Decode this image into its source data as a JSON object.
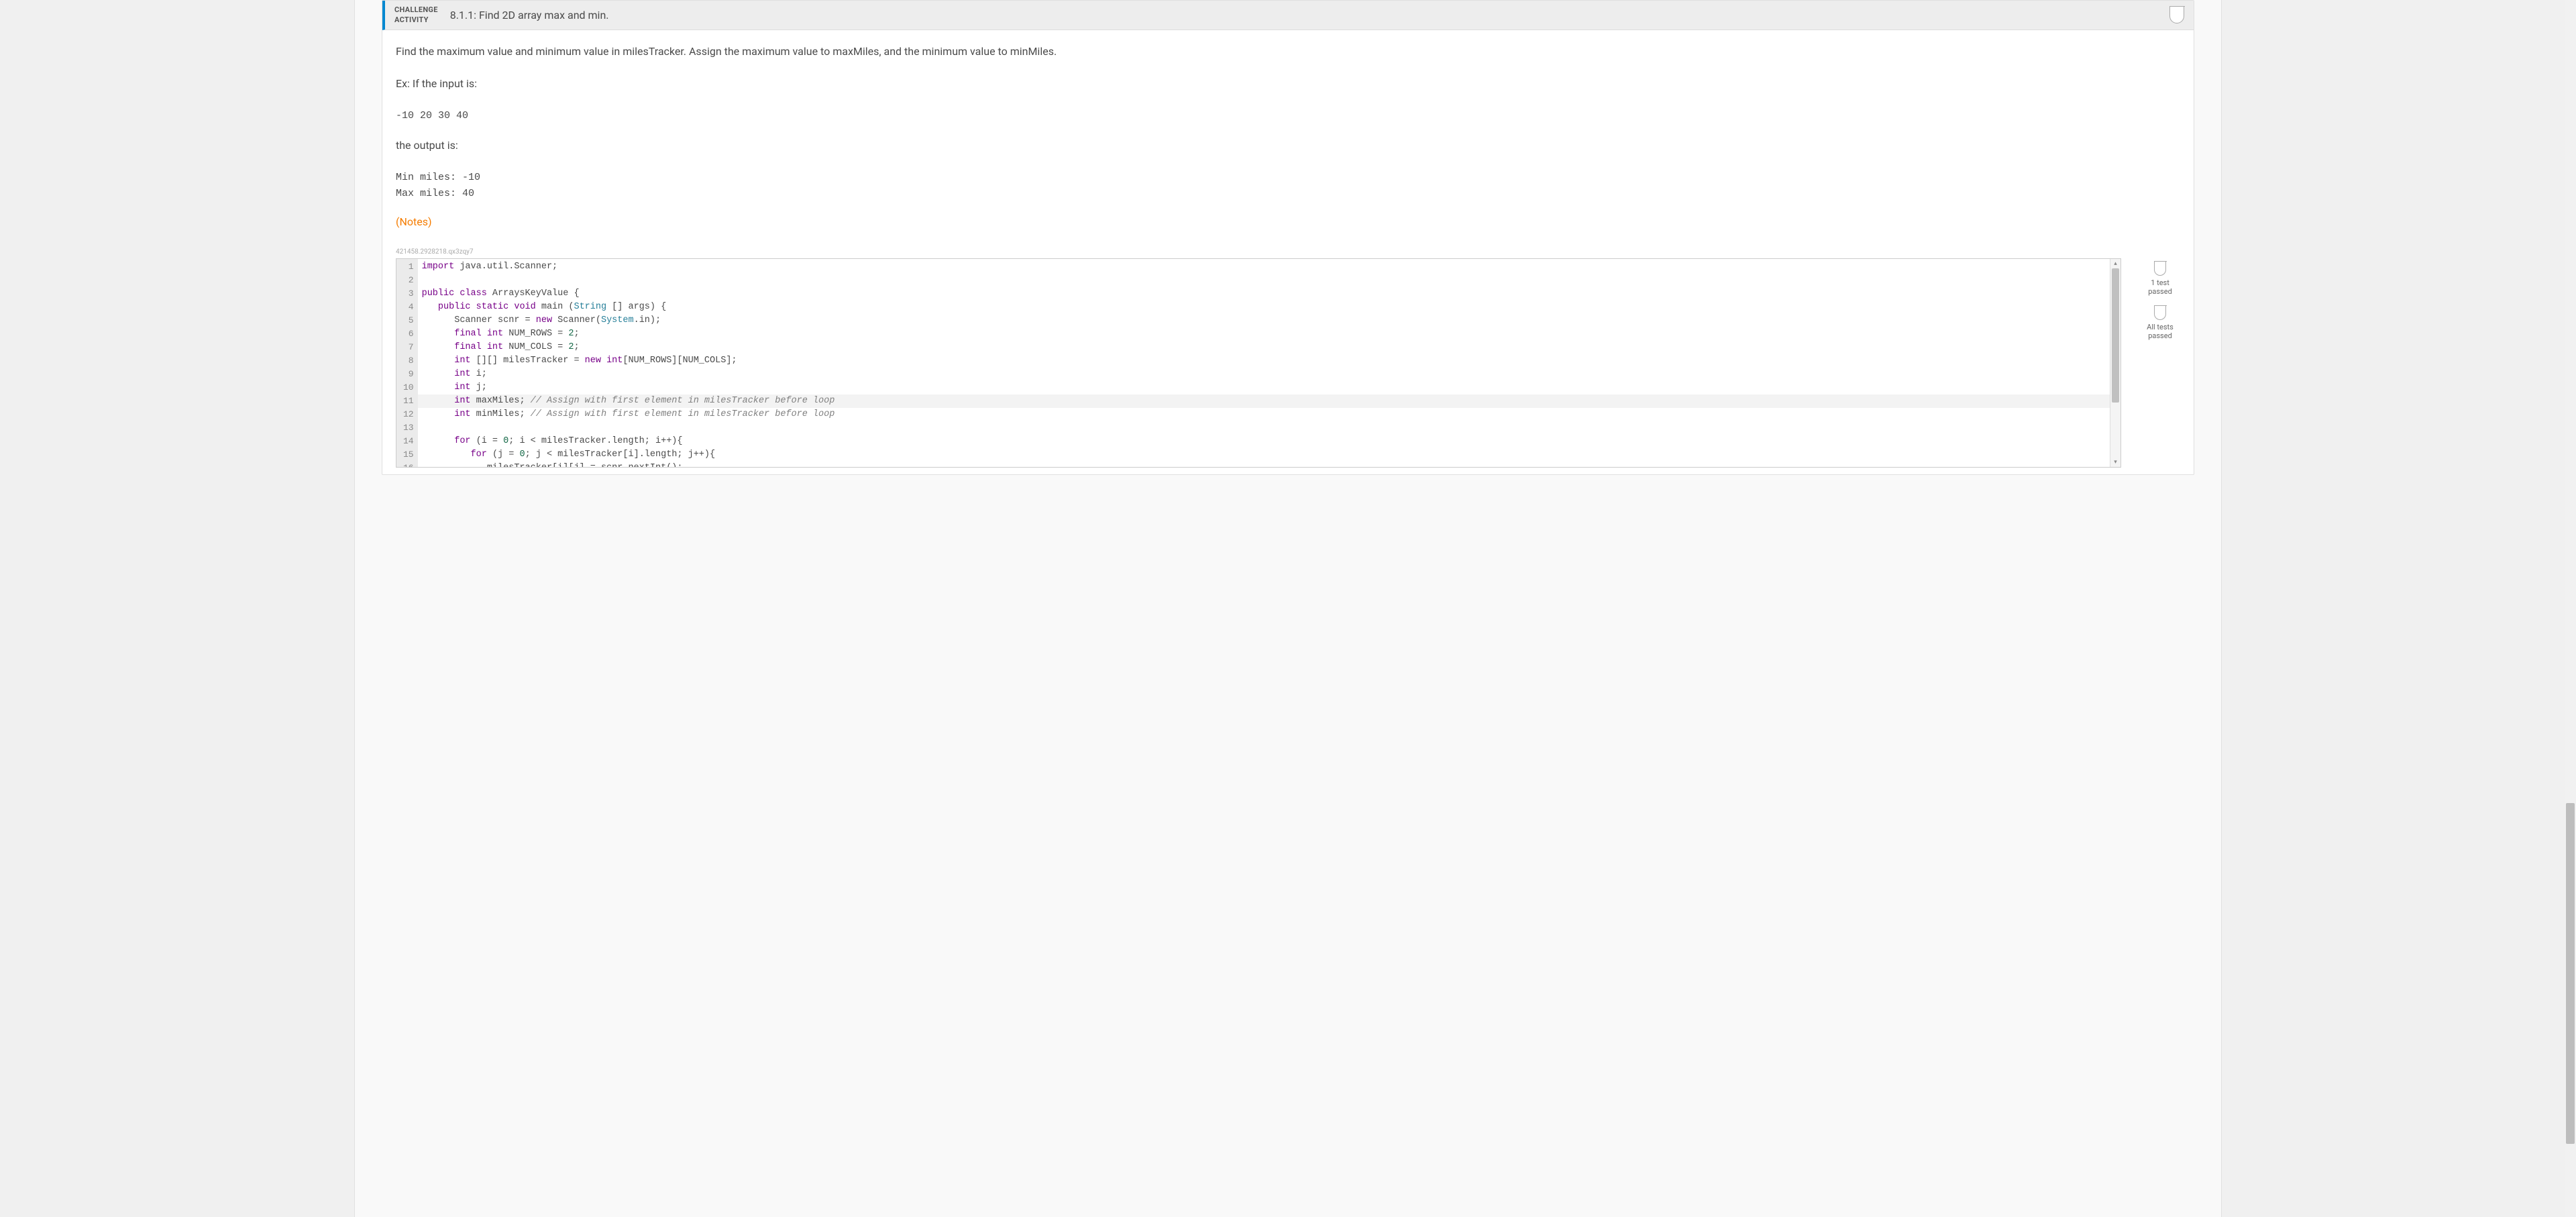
{
  "header": {
    "badge_line1": "CHALLENGE",
    "badge_line2": "ACTIVITY",
    "title": "8.1.1: Find 2D array max and min."
  },
  "description": "Find the maximum value and minimum value in milesTracker. Assign the maximum value to maxMiles, and the minimum value to minMiles.",
  "ex_label": "Ex: If the input is:",
  "ex_input": "-10 20 30 40",
  "output_label": "the output is:",
  "ex_output": "Min miles: -10\nMax miles: 40",
  "notes_label": "(Notes)",
  "watermark_id": "421458.2928218.qx3zqy7",
  "status": {
    "one_test": "1 test",
    "passed": "passed",
    "all_tests": "All tests"
  },
  "code_lines": [
    [
      {
        "t": "import",
        "c": "kw"
      },
      {
        "t": " java.util.Scanner;",
        "c": ""
      }
    ],
    [
      {
        "t": "",
        "c": ""
      }
    ],
    [
      {
        "t": "public class",
        "c": "kw"
      },
      {
        "t": " ArraysKeyValue {",
        "c": ""
      }
    ],
    [
      {
        "t": "   ",
        "c": ""
      },
      {
        "t": "public static void",
        "c": "kw"
      },
      {
        "t": " main (",
        "c": ""
      },
      {
        "t": "String",
        "c": "type"
      },
      {
        "t": " [] args) {",
        "c": ""
      }
    ],
    [
      {
        "t": "      Scanner scnr = ",
        "c": ""
      },
      {
        "t": "new",
        "c": "kw"
      },
      {
        "t": " Scanner(",
        "c": ""
      },
      {
        "t": "System",
        "c": "type"
      },
      {
        "t": ".in);",
        "c": ""
      }
    ],
    [
      {
        "t": "      ",
        "c": ""
      },
      {
        "t": "final int",
        "c": "kw"
      },
      {
        "t": " NUM_ROWS = ",
        "c": ""
      },
      {
        "t": "2",
        "c": "num"
      },
      {
        "t": ";",
        "c": ""
      }
    ],
    [
      {
        "t": "      ",
        "c": ""
      },
      {
        "t": "final int",
        "c": "kw"
      },
      {
        "t": " NUM_COLS = ",
        "c": ""
      },
      {
        "t": "2",
        "c": "num"
      },
      {
        "t": ";",
        "c": ""
      }
    ],
    [
      {
        "t": "      ",
        "c": ""
      },
      {
        "t": "int",
        "c": "kw"
      },
      {
        "t": " [][] milesTracker = ",
        "c": ""
      },
      {
        "t": "new int",
        "c": "kw"
      },
      {
        "t": "[NUM_ROWS][NUM_COLS];",
        "c": ""
      }
    ],
    [
      {
        "t": "      ",
        "c": ""
      },
      {
        "t": "int",
        "c": "kw"
      },
      {
        "t": " i;",
        "c": ""
      }
    ],
    [
      {
        "t": "      ",
        "c": ""
      },
      {
        "t": "int",
        "c": "kw"
      },
      {
        "t": " j;",
        "c": ""
      }
    ],
    [
      {
        "t": "      ",
        "c": ""
      },
      {
        "t": "int",
        "c": "kw"
      },
      {
        "t": " maxMiles; ",
        "c": ""
      },
      {
        "t": "// Assign with first element in milesTracker before loop",
        "c": "cmt"
      }
    ],
    [
      {
        "t": "      ",
        "c": ""
      },
      {
        "t": "int",
        "c": "kw"
      },
      {
        "t": " minMiles; ",
        "c": ""
      },
      {
        "t": "// Assign with first element in milesTracker before loop",
        "c": "cmt"
      }
    ],
    [
      {
        "t": "",
        "c": ""
      }
    ],
    [
      {
        "t": "      ",
        "c": ""
      },
      {
        "t": "for",
        "c": "kw"
      },
      {
        "t": " (i = ",
        "c": ""
      },
      {
        "t": "0",
        "c": "num"
      },
      {
        "t": "; i < milesTracker.length; i++){",
        "c": ""
      }
    ],
    [
      {
        "t": "         ",
        "c": ""
      },
      {
        "t": "for",
        "c": "kw"
      },
      {
        "t": " (j = ",
        "c": ""
      },
      {
        "t": "0",
        "c": "num"
      },
      {
        "t": "; j < milesTracker[i].length; j++){",
        "c": ""
      }
    ],
    [
      {
        "t": "            milesTracker[i][j] = scnr.nextInt();",
        "c": ""
      }
    ],
    [
      {
        "t": "         }",
        "c": ""
      }
    ],
    [
      {
        "t": "      }",
        "c": ""
      }
    ]
  ],
  "highlight_line_index": 10,
  "scroll_arrows": {
    "up": "▴",
    "down": "▾"
  }
}
